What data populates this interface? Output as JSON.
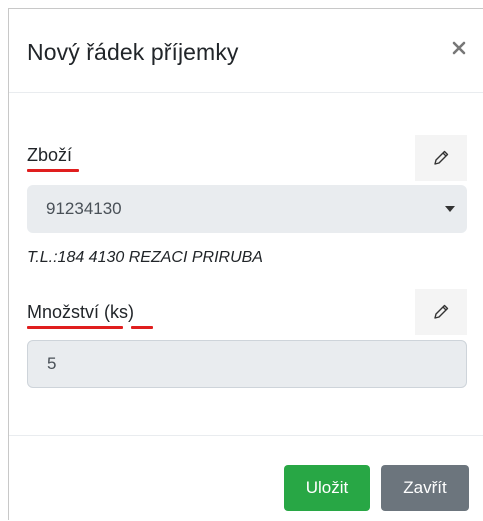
{
  "modal": {
    "title": "Nový řádek příjemky",
    "close_glyph": "×"
  },
  "fields": {
    "item": {
      "label": "Zboží",
      "selected_value": "91234130",
      "description": "T.L.:184 4130 REZACI PRIRUBA"
    },
    "quantity": {
      "label": "Množství (ks)",
      "value": "5"
    }
  },
  "footer": {
    "save_label": "Uložit",
    "close_label": "Zavřít"
  },
  "colors": {
    "save": "#28a745",
    "close": "#6c757d",
    "spellcheck": "#e01e1e"
  },
  "icons": {
    "edit": "pencil-icon",
    "close": "close-icon",
    "dropdown": "caret-down-icon"
  }
}
